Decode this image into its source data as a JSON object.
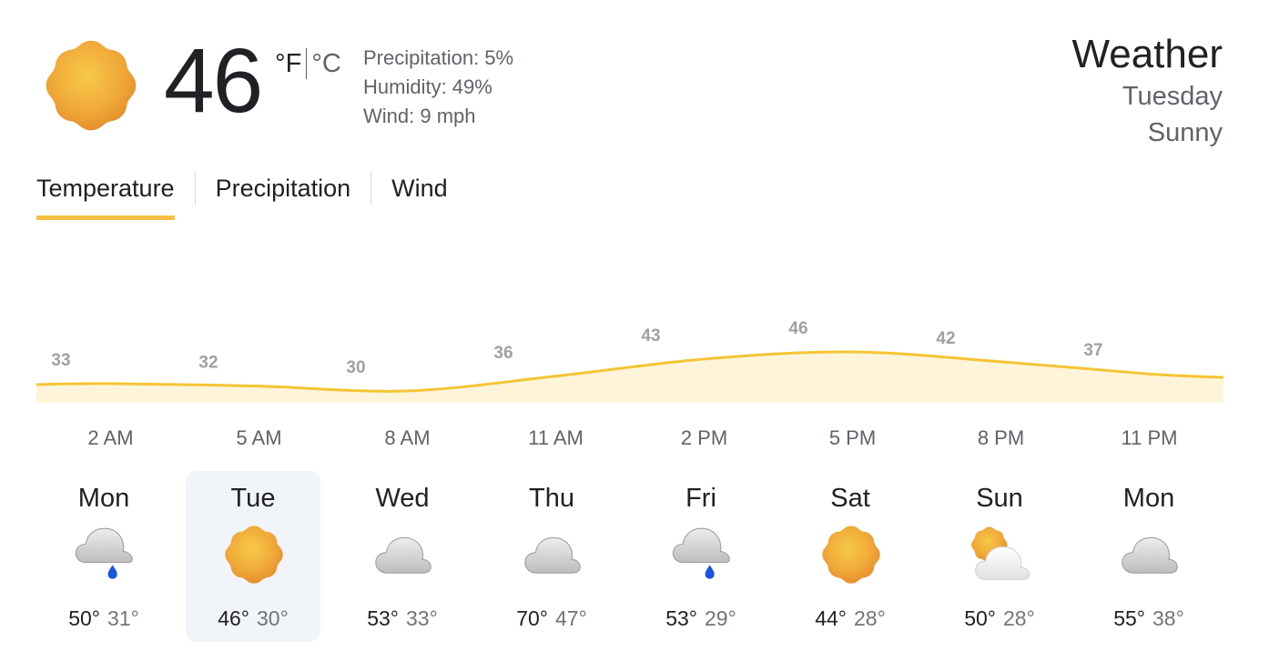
{
  "current": {
    "temperature": "46",
    "unit_f": "°F",
    "unit_c": "°C",
    "icon": "sun-icon",
    "precipitation": "Precipitation: 5%",
    "humidity": "Humidity: 49%",
    "wind": "Wind: 9 mph"
  },
  "header": {
    "title": "Weather",
    "day": "Tuesday",
    "condition": "Sunny"
  },
  "tabs": [
    {
      "label": "Temperature",
      "active": true
    },
    {
      "label": "Precipitation",
      "active": false
    },
    {
      "label": "Wind",
      "active": false
    }
  ],
  "chart_data": {
    "type": "area",
    "x": [
      "2 AM",
      "5 AM",
      "8 AM",
      "11 AM",
      "2 PM",
      "5 PM",
      "8 PM",
      "11 PM"
    ],
    "values": [
      33,
      32,
      30,
      36,
      43,
      46,
      42,
      37
    ],
    "color": "#f4c534",
    "fill": "#fdf4d9"
  },
  "days": [
    {
      "name": "Mon",
      "icon": "cloud-rain-icon",
      "high": "50°",
      "low": "31°"
    },
    {
      "name": "Tue",
      "icon": "sun-icon",
      "high": "46°",
      "low": "30°",
      "selected": true
    },
    {
      "name": "Wed",
      "icon": "cloud-icon",
      "high": "53°",
      "low": "33°"
    },
    {
      "name": "Thu",
      "icon": "cloud-icon",
      "high": "70°",
      "low": "47°"
    },
    {
      "name": "Fri",
      "icon": "cloud-rain-icon",
      "high": "53°",
      "low": "29°"
    },
    {
      "name": "Sat",
      "icon": "sun-icon",
      "high": "44°",
      "low": "28°"
    },
    {
      "name": "Sun",
      "icon": "partly-cloudy-icon",
      "high": "50°",
      "low": "28°"
    },
    {
      "name": "Mon",
      "icon": "cloud-icon",
      "high": "55°",
      "low": "38°"
    }
  ],
  "colors": {
    "accent": "#f4bf42",
    "rain": "#1a56db",
    "selected_bg": "#f1f5f9"
  }
}
